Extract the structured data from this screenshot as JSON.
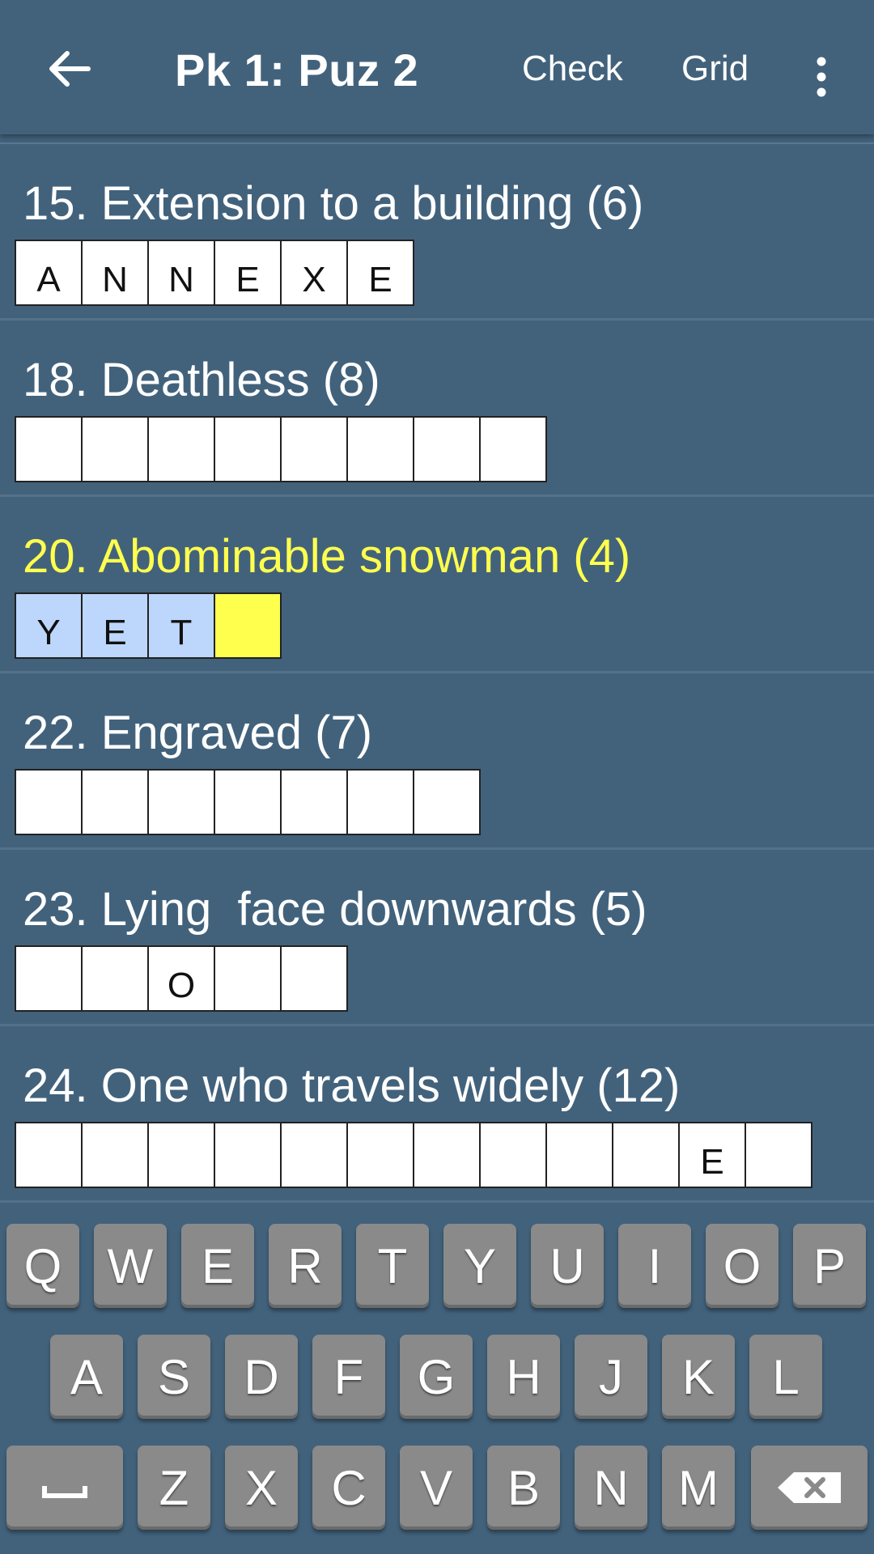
{
  "appbar": {
    "title": "Pk 1: Puz 2",
    "actions": [
      "Check",
      "Grid"
    ],
    "back_icon": "arrow-left-icon",
    "more_icon": "more-vert-icon"
  },
  "clues": [
    {
      "label": "15. Extension to a building (6)",
      "cells": [
        "A",
        "N",
        "N",
        "E",
        "X",
        "E"
      ],
      "active": false
    },
    {
      "label": "18. Deathless (8)",
      "cells": [
        "",
        "",
        "",
        "",
        "",
        "",
        "",
        ""
      ],
      "active": false
    },
    {
      "label": "20. Abominable snowman (4)",
      "cells": [
        "Y",
        "E",
        "T",
        ""
      ],
      "active": true
    },
    {
      "label": "22. Engraved (7)",
      "cells": [
        "",
        "",
        "",
        "",
        "",
        "",
        ""
      ],
      "active": false
    },
    {
      "label": "23. Lying  face downwards (5)",
      "cells": [
        "",
        "",
        "O",
        "",
        ""
      ],
      "active": false
    },
    {
      "label": "24. One who travels widely (12)",
      "cells": [
        "",
        "",
        "",
        "",
        "",
        "",
        "",
        "",
        "",
        "",
        "E",
        ""
      ],
      "active": false
    }
  ],
  "keyboard": {
    "row1": [
      "Q",
      "W",
      "E",
      "R",
      "T",
      "Y",
      "U",
      "I",
      "O",
      "P"
    ],
    "row2": [
      "A",
      "S",
      "D",
      "F",
      "G",
      "H",
      "J",
      "K",
      "L"
    ],
    "row3": [
      "Z",
      "X",
      "C",
      "V",
      "B",
      "N",
      "M"
    ],
    "space_icon": "space-bar-icon",
    "backspace_icon": "backspace-icon"
  },
  "colors": {
    "background": "#42627c",
    "active_clue_text": "#ffff4d",
    "current_cell": "#ffff4d",
    "filled_word_cell": "#bcd7fb",
    "key": "#8a8a8a"
  }
}
